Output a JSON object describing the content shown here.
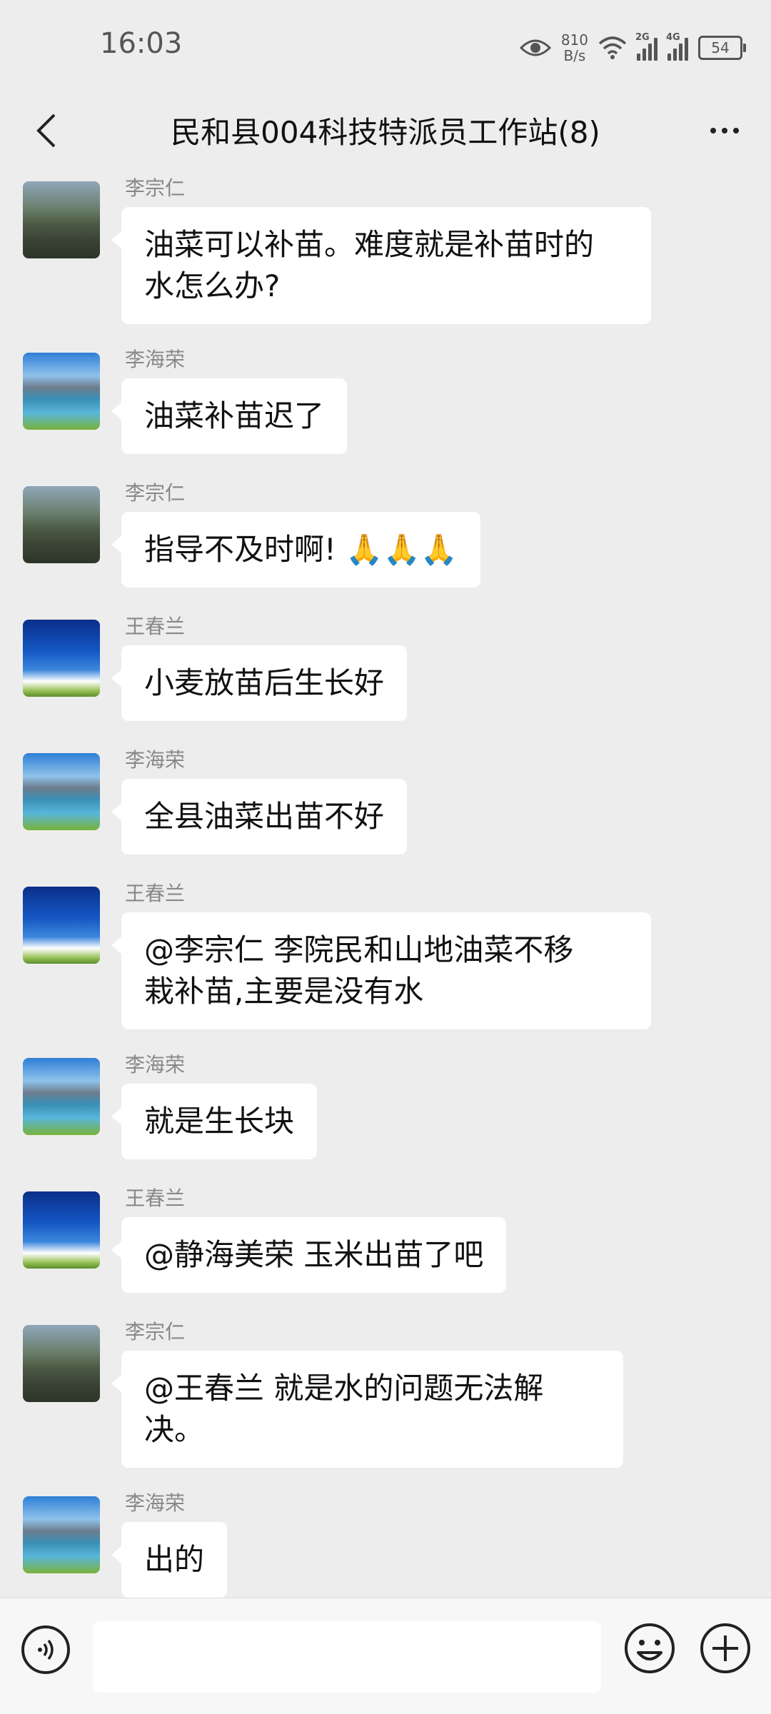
{
  "status_bar": {
    "time": "16:03",
    "net_speed_value": "810",
    "net_speed_unit": "B/s",
    "sim1_tag": "2G",
    "sim2_tag": "4G",
    "battery": "54",
    "icons": [
      "eye-icon",
      "wifi-icon",
      "signal-icon",
      "battery-icon"
    ]
  },
  "header": {
    "title": "民和县004科技特派员工作站(8)",
    "back_icon": "chevron-left-icon",
    "more_icon": "more-dots-icon"
  },
  "messages": [
    {
      "sender": "李宗仁",
      "text_lines": [
        "油菜可以补苗。难度就是补苗时的",
        "水怎么办?"
      ],
      "avatar": "mountain-lake"
    },
    {
      "sender": "李海荣",
      "text_lines": [
        "油菜补苗迟了"
      ],
      "avatar": "blue-mountain-lake"
    },
    {
      "sender": "李宗仁",
      "text_lines": [
        "指导不及时啊!"
      ],
      "emoji": "🙏🙏🙏",
      "avatar": "mountain-lake"
    },
    {
      "sender": "王春兰",
      "text_lines": [
        "小麦放苗后生长好"
      ],
      "avatar": "blue-sky"
    },
    {
      "sender": "李海荣",
      "text_lines": [
        "全县油菜出苗不好"
      ],
      "avatar": "blue-mountain-lake"
    },
    {
      "sender": "王春兰",
      "text_lines": [
        "@李宗仁 李院民和山地油菜不移",
        "栽补苗,主要是没有水"
      ],
      "avatar": "blue-sky"
    },
    {
      "sender": "李海荣",
      "text_lines": [
        "就是生长块"
      ],
      "avatar": "blue-mountain-lake"
    },
    {
      "sender": "王春兰",
      "text_lines": [
        "@静海美荣 玉米出苗了吧"
      ],
      "avatar": "blue-sky"
    },
    {
      "sender": "李宗仁",
      "text_lines": [
        "@王春兰 就是水的问题无法解",
        "决。"
      ],
      "avatar": "mountain-lake"
    },
    {
      "sender": "李海荣",
      "text_lines": [
        "出的"
      ],
      "avatar": "blue-mountain-lake"
    }
  ],
  "input_bar": {
    "value": "",
    "voice_icon": "voice-icon",
    "emoji_icon": "emoji-icon",
    "plus_icon": "plus-icon"
  }
}
